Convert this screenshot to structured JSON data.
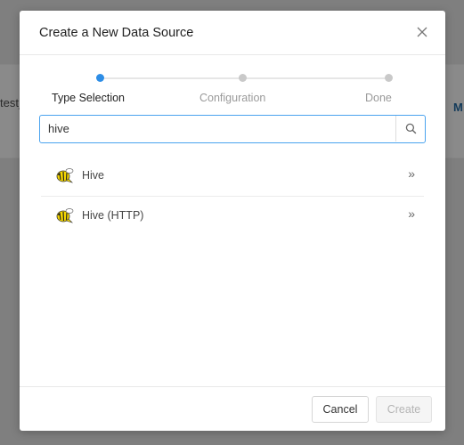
{
  "background": {
    "left_text": "test_",
    "right_text": "M"
  },
  "modal": {
    "title": "Create a New Data Source",
    "steps": [
      {
        "label": "Type Selection",
        "state": "active"
      },
      {
        "label": "Configuration",
        "state": "pending"
      },
      {
        "label": "Done",
        "state": "pending"
      }
    ],
    "search": {
      "value": "hive",
      "placeholder": ""
    },
    "items": [
      {
        "label": "Hive",
        "icon": "hive-bee-icon"
      },
      {
        "label": "Hive (HTTP)",
        "icon": "hive-bee-icon"
      }
    ],
    "chevron": "»",
    "footer": {
      "cancel_label": "Cancel",
      "create_label": "Create"
    }
  },
  "colors": {
    "accent": "#2d8de6",
    "search_border": "#4aa3ee",
    "overlay": "#7f7f7f"
  }
}
